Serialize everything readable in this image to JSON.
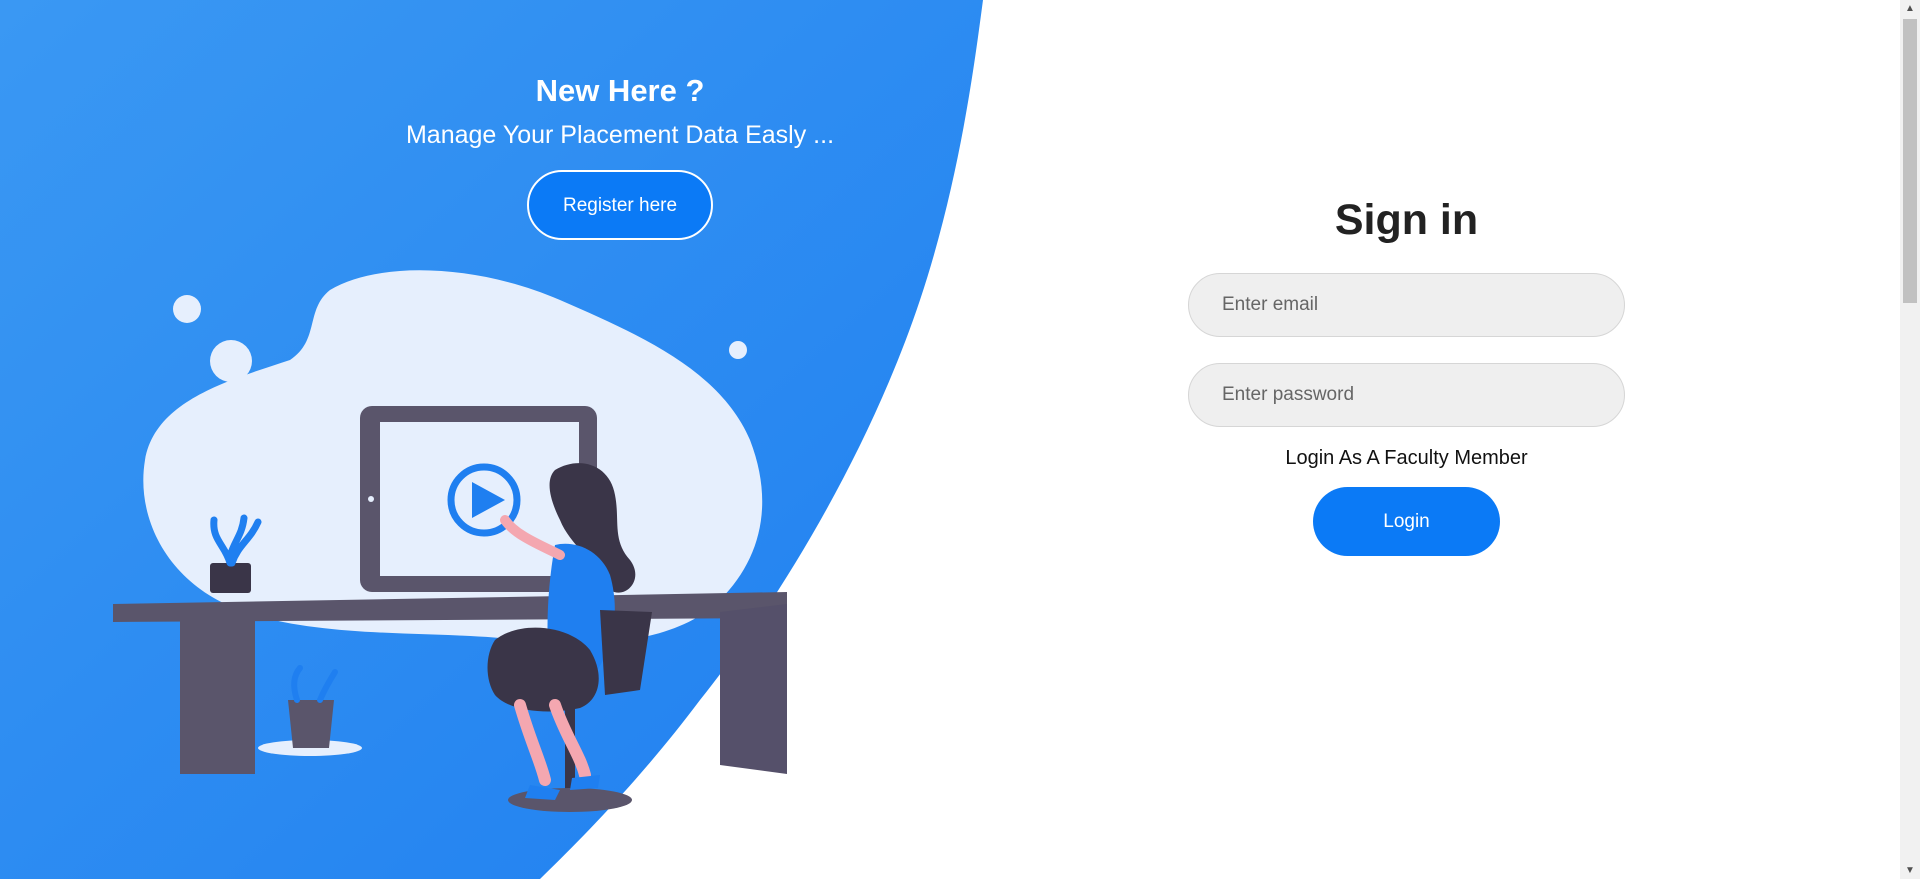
{
  "hero": {
    "title": "New Here ?",
    "subtitle": "Manage Your Placement Data Easly ...",
    "register_label": "Register here"
  },
  "signin": {
    "title": "Sign in",
    "email_placeholder": "Enter email",
    "password_placeholder": "Enter password",
    "faculty_link": "Login As A Faculty Member",
    "login_label": "Login"
  },
  "colors": {
    "primary_blue": "#0b7af6",
    "panel_blue_light": "#3a98f3",
    "panel_blue_dark": "#1f7ff0",
    "blob_light": "#e6effd",
    "desk_dark": "#5a556b",
    "field_bg": "#efefef"
  },
  "icons": {
    "illustration": "person-at-desk-illustration",
    "play": "play-icon",
    "scroll_up": "arrow-up-icon",
    "scroll_down": "arrow-down-icon"
  },
  "scrollbar": {
    "scroll_fraction": 0.0
  }
}
